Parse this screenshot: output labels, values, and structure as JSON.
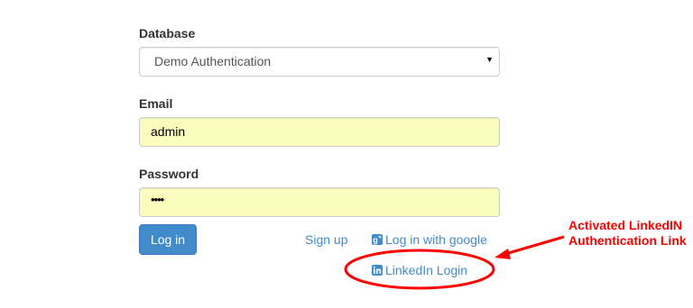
{
  "form": {
    "database": {
      "label": "Database",
      "selected": "Demo Authentication"
    },
    "email": {
      "label": "Email",
      "value": "admin"
    },
    "password": {
      "label": "Password",
      "value": "••••"
    }
  },
  "actions": {
    "login_label": "Log in",
    "signup_label": "Sign up",
    "google_label": "Log in with google",
    "linkedin_label": "LinkedIn Login"
  },
  "annotation": {
    "line1": "Activated LinkedIN",
    "line2": "Authentication Link",
    "color": "#ff0000"
  },
  "colors": {
    "primary": "#428bca",
    "autofill": "#fafdbd"
  },
  "icons": {
    "google": "google-plus-icon",
    "linkedin": "linkedin-icon",
    "select": "caret-down-icon"
  }
}
